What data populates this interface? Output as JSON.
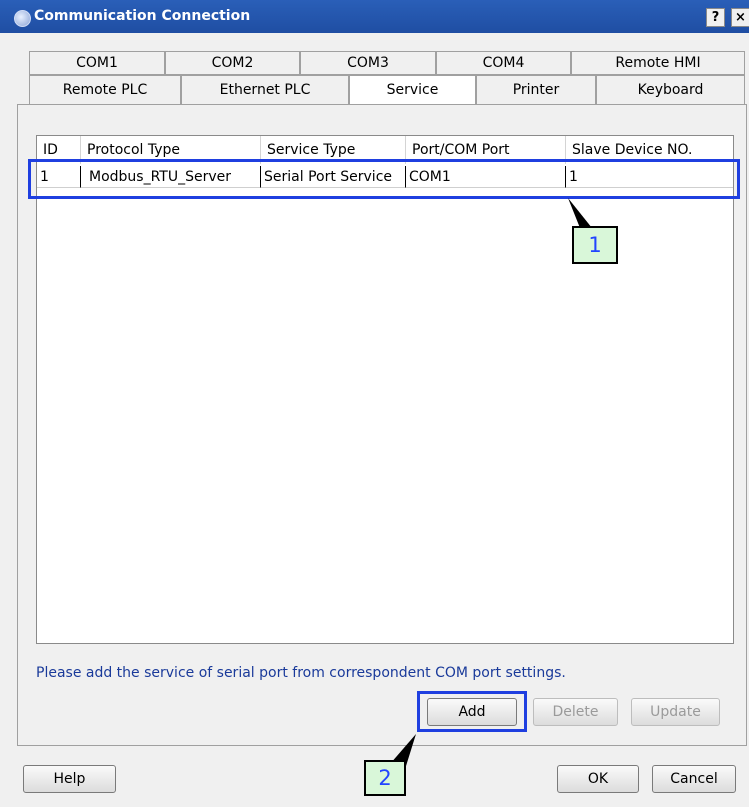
{
  "window": {
    "title": "Communication Connection",
    "help_glyph": "?",
    "close_glyph": "×"
  },
  "tabs_row1": [
    "COM1",
    "COM2",
    "COM3",
    "COM4",
    "Remote HMI"
  ],
  "tabs_row2": [
    "Remote PLC",
    "Ethernet PLC",
    "Service",
    "Printer",
    "Keyboard"
  ],
  "selected_tab": "Service",
  "table": {
    "columns": [
      "ID",
      "Protocol Type",
      "Service Type",
      "Port/COM Port",
      "Slave Device NO."
    ],
    "rows": [
      {
        "id": "1",
        "protocol": "Modbus_RTU_Server",
        "service": "Serial Port Service",
        "port": "COM1",
        "slave": "1"
      }
    ]
  },
  "hint": "Please add the service of serial port from correspondent COM port settings.",
  "buttons": {
    "add": "Add",
    "delete": "Delete",
    "update": "Update",
    "help": "Help",
    "ok": "OK",
    "cancel": "Cancel"
  },
  "callouts": {
    "one": "1",
    "two": "2"
  },
  "colors": {
    "highlight": "#1f3fe0",
    "callout_bg": "#d9f7d9",
    "callout_text": "#2244ff",
    "hint_text": "#1a3a9a"
  }
}
